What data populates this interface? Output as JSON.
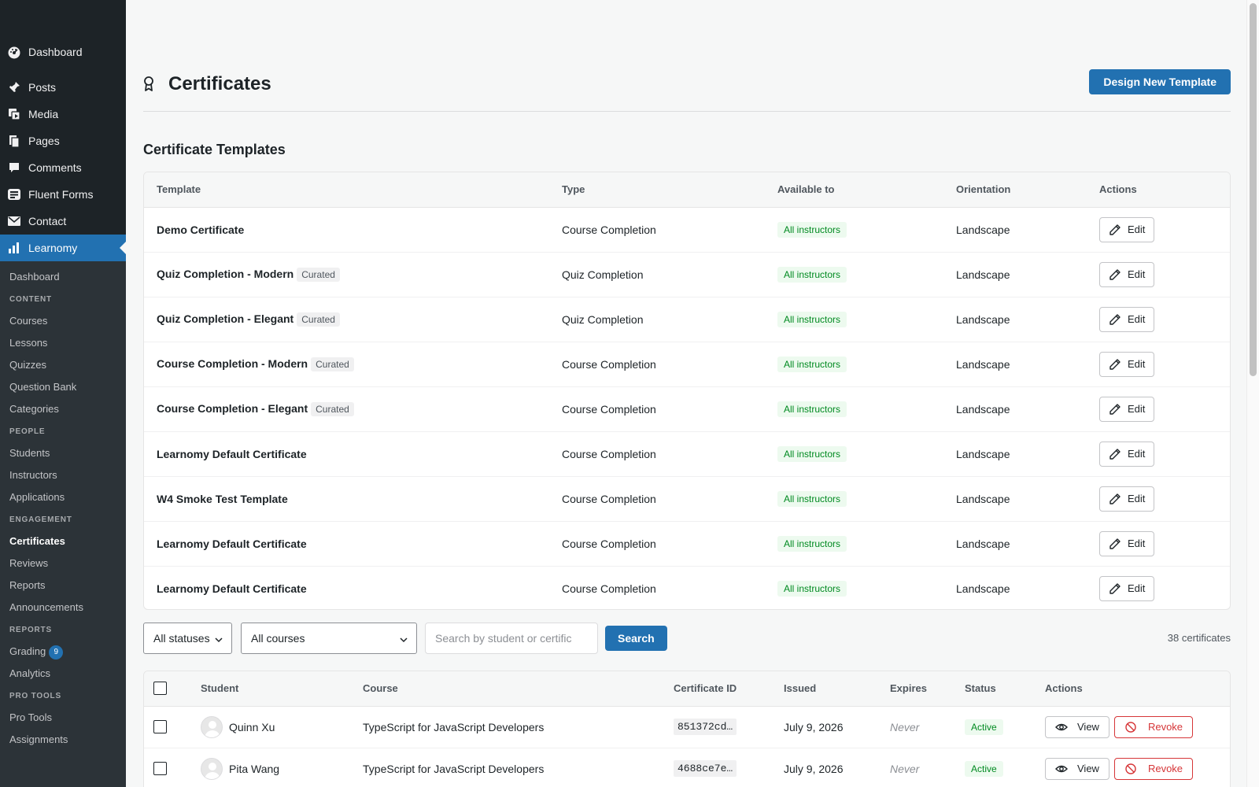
{
  "sidebar": {
    "top": {
      "dashboard": "Dashboard"
    },
    "items": {
      "posts": "Posts",
      "media": "Media",
      "pages": "Pages",
      "comments": "Comments",
      "fluent_forms": "Fluent Forms",
      "contact": "Contact",
      "learnomy": "Learnomy"
    },
    "sub": {
      "dashboard": "Dashboard",
      "content_header": "CONTENT",
      "courses": "Courses",
      "lessons": "Lessons",
      "quizzes": "Quizzes",
      "question_bank": "Question Bank",
      "categories": "Categories",
      "people_header": "PEOPLE",
      "students": "Students",
      "instructors": "Instructors",
      "applications": "Applications",
      "engagement_header": "ENGAGEMENT",
      "certificates": "Certificates",
      "reviews": "Reviews",
      "reports": "Reports",
      "announcements": "Announcements",
      "reports_header": "REPORTS",
      "grading": "Grading",
      "grading_badge": "9",
      "analytics": "Analytics",
      "pro_tools_header": "PRO TOOLS",
      "pro_tools": "Pro Tools",
      "assignments": "Assignments"
    }
  },
  "header": {
    "title": "Certificates",
    "design_button": "Design New Template"
  },
  "templates": {
    "section_title": "Certificate Templates",
    "columns": {
      "template": "Template",
      "type": "Type",
      "available_to": "Available to",
      "orientation": "Orientation",
      "actions": "Actions"
    },
    "edit_label": "Edit",
    "rows": [
      {
        "name": "Demo Certificate",
        "badge": "",
        "type": "Course Completion",
        "available": "All instructors",
        "orientation": "Landscape"
      },
      {
        "name": "Quiz Completion - Modern",
        "badge": "Curated",
        "type": "Quiz Completion",
        "available": "All instructors",
        "orientation": "Landscape"
      },
      {
        "name": "Quiz Completion - Elegant",
        "badge": "Curated",
        "type": "Quiz Completion",
        "available": "All instructors",
        "orientation": "Landscape"
      },
      {
        "name": "Course Completion - Modern",
        "badge": "Curated",
        "type": "Course Completion",
        "available": "All instructors",
        "orientation": "Landscape"
      },
      {
        "name": "Course Completion - Elegant",
        "badge": "Curated",
        "type": "Course Completion",
        "available": "All instructors",
        "orientation": "Landscape"
      },
      {
        "name": "Learnomy Default Certificate",
        "badge": "",
        "type": "Course Completion",
        "available": "All instructors",
        "orientation": "Landscape"
      },
      {
        "name": "W4 Smoke Test Template",
        "badge": "",
        "type": "Course Completion",
        "available": "All instructors",
        "orientation": "Landscape"
      },
      {
        "name": "Learnomy Default Certificate",
        "badge": "",
        "type": "Course Completion",
        "available": "All instructors",
        "orientation": "Landscape"
      },
      {
        "name": "Learnomy Default Certificate",
        "badge": "",
        "type": "Course Completion",
        "available": "All instructors",
        "orientation": "Landscape"
      }
    ]
  },
  "filters": {
    "status_select": "All statuses",
    "course_select": "All courses",
    "search_placeholder": "Search by student or certific",
    "search_button": "Search",
    "count": "38 certificates"
  },
  "certificates": {
    "columns": {
      "student": "Student",
      "course": "Course",
      "certificate_id": "Certificate ID",
      "issued": "Issued",
      "expires": "Expires",
      "status": "Status",
      "actions": "Actions"
    },
    "view_label": "View",
    "revoke_label": "Revoke",
    "rows": [
      {
        "student": "Quinn Xu",
        "course": "TypeScript for JavaScript Developers",
        "id": "851372cd…",
        "issued": "July 9, 2026",
        "expires": "Never",
        "status": "Active"
      },
      {
        "student": "Pita Wang",
        "course": "TypeScript for JavaScript Developers",
        "id": "4688ce7e…",
        "issued": "July 9, 2026",
        "expires": "Never",
        "status": "Active"
      }
    ]
  },
  "icons": {
    "dashboard": "dashboard-icon",
    "posts": "pin-icon",
    "media": "media-icon",
    "pages": "pages-icon",
    "comments": "comment-icon",
    "fluent_forms": "form-icon",
    "contact": "mail-icon",
    "learnomy": "chart-icon",
    "certificates": "award-icon",
    "edit": "pencil-icon",
    "view": "eye-icon",
    "revoke": "ban-icon"
  },
  "colors": {
    "accent": "#2271b1",
    "sidebar": "#1d2327",
    "success": "#008a20",
    "danger": "#d63638"
  }
}
